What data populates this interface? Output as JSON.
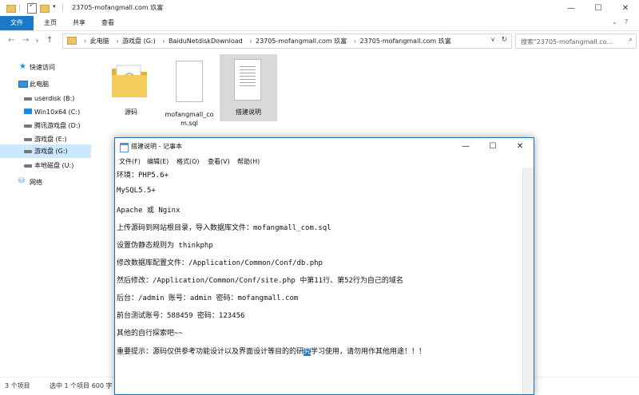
{
  "explorer": {
    "title": "23705-mofangmall.com 玖富",
    "ribbon_tabs": [
      "文件",
      "主页",
      "共享",
      "查看"
    ],
    "breadcrumbs": [
      "此电脑",
      "游戏盘 (G:)",
      "BaiduNetdiskDownload",
      "23705-mofangmall.com 玖富",
      "23705-mofangmall.com 玖富"
    ],
    "search_placeholder": "搜索\"23705-mofangmall.co...",
    "nav": [
      "快速访问",
      "此电脑",
      "userdisk (B:)",
      "Win10x64 (C:)",
      "腾讯游戏盘 (D:)",
      "游戏盘 (E:)",
      "游戏盘 (G:)",
      "本地磁盘 (U:)",
      "网络"
    ],
    "files": [
      {
        "name": "源码",
        "type": "folder"
      },
      {
        "name": "mofangmall_com.sql",
        "name_lines": [
          "mofangmall_co",
          "m.sql"
        ],
        "type": "file"
      },
      {
        "name": "搭建说明",
        "type": "text"
      }
    ],
    "status": {
      "count": "3 个项目",
      "selected": "选中 1 个项目  600 字"
    }
  },
  "notepad": {
    "title": "搭建说明 - 记事本",
    "menu": [
      "文件(F)",
      "编辑(E)",
      "格式(O)",
      "查看(V)",
      "帮助(H)"
    ],
    "lines": [
      "环境：PHP5.6+",
      "MySQL5.5+",
      "Apache  或 Nginx",
      "上传源码到网站根目录，导入数据库文件：mofangmall_com.sql",
      "设置伪静态规则为 thinkphp",
      "修改数据库配置文件：/Application/Common/Conf/db.php",
      "然后修改：/Application/Common/Conf/site.php 中第11行、第52行为自己的域名",
      "后台：/admin   账号：admin    密码：mofangmall.com",
      "前台测试账号：588459   密码：123456",
      "其他的自行探索吧~~"
    ],
    "last_line": {
      "before": "重要提示：源码仅供参考功能设计以及界面设计等目的的研",
      "selected": "究",
      "after": "学习使用，请勿用作其他用途！！！"
    }
  },
  "colors": {
    "accent": "#1979ca",
    "selection": "#cce8ff",
    "folder": "#e9c46a"
  }
}
